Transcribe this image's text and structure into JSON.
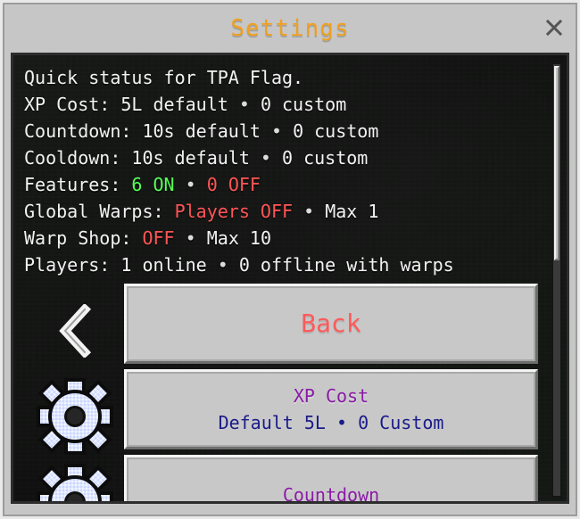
{
  "window": {
    "title": "Settings",
    "close_icon": "close-icon"
  },
  "status": {
    "line1": "Quick status for TPA Flag.",
    "xp_cost": {
      "label": "XP Cost:",
      "default": "5L default",
      "bullet": "•",
      "custom": "0 custom"
    },
    "countdown": {
      "label": "Countdown:",
      "default": "10s default",
      "bullet": "•",
      "custom": "0 custom"
    },
    "cooldown": {
      "label": "Cooldown:",
      "default": "10s default",
      "bullet": "•",
      "custom": "0 custom"
    },
    "features": {
      "label": "Features:",
      "on": "6 ON",
      "bullet": "•",
      "off": "0 OFF"
    },
    "global_warps": {
      "label": "Global Warps:",
      "players": "Players OFF",
      "bullet": "•",
      "max": "Max 1"
    },
    "warp_shop": {
      "label": "Warp Shop:",
      "state": "OFF",
      "bullet": "•",
      "max": "Max 10"
    },
    "players": {
      "label": "Players:",
      "online": "1 online",
      "bullet": "•",
      "offline": "0 offline with warps"
    }
  },
  "menu": {
    "back": {
      "label": "Back",
      "icon": "chevron-left-icon"
    },
    "xp_cost": {
      "label": "XP Cost",
      "sub": "Default 5L • 0 Custom",
      "icon": "gear-icon"
    },
    "countdown": {
      "label": "Countdown",
      "icon": "gear-icon"
    }
  },
  "scroll": {
    "thumb": "scroll-thumb"
  },
  "colors": {
    "title": "#f0a020",
    "good": "#55ff55",
    "bad": "#ff5555",
    "button_label": "#8a1aa6",
    "button_sub": "#1a1a8a"
  }
}
